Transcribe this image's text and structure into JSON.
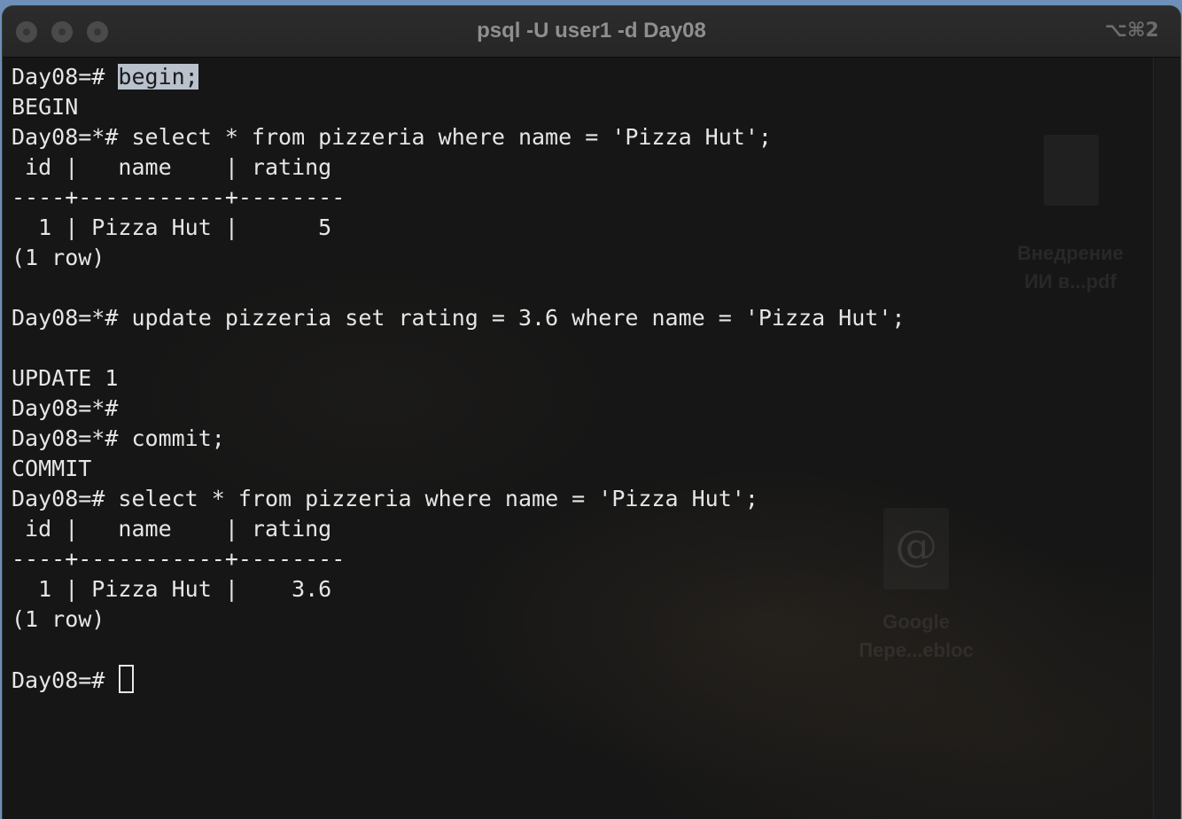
{
  "window": {
    "title": "psql -U user1 -d Day08",
    "shortcut": "⌥⌘2"
  },
  "terminal": {
    "lines": [
      {
        "prompt": "Day08=# ",
        "text": "begin;",
        "selected": true
      },
      {
        "text": "BEGIN"
      },
      {
        "prompt": "Day08=*# ",
        "text": "select * from pizzeria where name = 'Pizza Hut';"
      },
      {
        "text": " id |   name    | rating "
      },
      {
        "text": "----+-----------+--------"
      },
      {
        "text": "  1 | Pizza Hut |      5"
      },
      {
        "text": "(1 row)"
      },
      {
        "text": ""
      },
      {
        "prompt": "Day08=*# ",
        "text": "update pizzeria set rating = 3.6 where name = 'Pizza Hut';"
      },
      {
        "text": ""
      },
      {
        "text": "UPDATE 1"
      },
      {
        "prompt": "Day08=*# ",
        "text": ""
      },
      {
        "prompt": "Day08=*# ",
        "text": "commit;"
      },
      {
        "text": "COMMIT"
      },
      {
        "prompt": "Day08=# ",
        "text": "select * from pizzeria where name = 'Pizza Hut';"
      },
      {
        "text": " id |   name    | rating "
      },
      {
        "text": "----+-----------+--------"
      },
      {
        "text": "  1 | Pizza Hut |    3.6"
      },
      {
        "text": "(1 row)"
      },
      {
        "text": ""
      },
      {
        "prompt": "Day08=# ",
        "text": "",
        "cursor": true
      }
    ]
  },
  "desktop_icons": [
    {
      "label_line1": "Внедрение",
      "label_line2": "ИИ в...pdf",
      "icon": "pdf-document-icon"
    },
    {
      "label_line1": "Google",
      "label_line2": "Пере...ebloc",
      "icon": "webloc-link-icon"
    }
  ]
}
